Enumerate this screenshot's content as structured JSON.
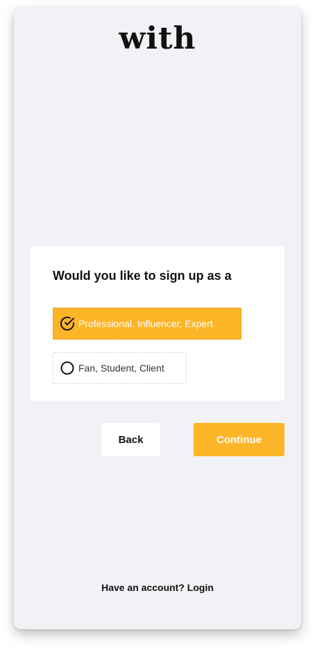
{
  "brand": {
    "logo_text": "with",
    "accent_color": "#fdb528"
  },
  "signup": {
    "question": "Would you like to sign up as a",
    "options": [
      {
        "label": "Professional, Influencer, Expert",
        "selected": true,
        "icon": "check-circle-icon"
      },
      {
        "label": "Fan, Student, Client",
        "selected": false,
        "icon": "radio-circle-icon"
      }
    ]
  },
  "actions": {
    "back_label": "Back",
    "continue_label": "Continue"
  },
  "footer": {
    "prompt": "Have an account?",
    "login_label": "Login"
  }
}
